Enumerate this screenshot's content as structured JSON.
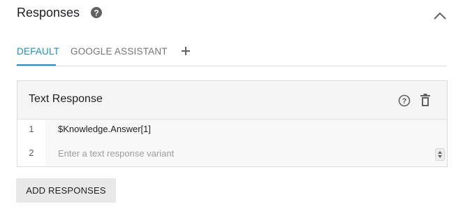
{
  "section": {
    "title": "Responses",
    "help_icon": "help-circle-icon",
    "collapse_icon": "chevron-up-icon"
  },
  "tabs": [
    {
      "label": "DEFAULT",
      "active": true
    },
    {
      "label": "GOOGLE ASSISTANT",
      "active": false
    }
  ],
  "add_tab_icon": "plus-icon",
  "card": {
    "title": "Text Response",
    "help_icon": "help-outline-icon",
    "delete_icon": "trash-icon",
    "rows": [
      {
        "number": "1",
        "text": "$Knowledge.Answer[1]"
      },
      {
        "number": "2",
        "value": "",
        "placeholder": "Enter a text response variant"
      }
    ]
  },
  "add_button": {
    "label": "ADD RESPONSES"
  },
  "colors": {
    "accent": "#1a8fd0",
    "muted": "#757575",
    "icon": "#616161"
  }
}
